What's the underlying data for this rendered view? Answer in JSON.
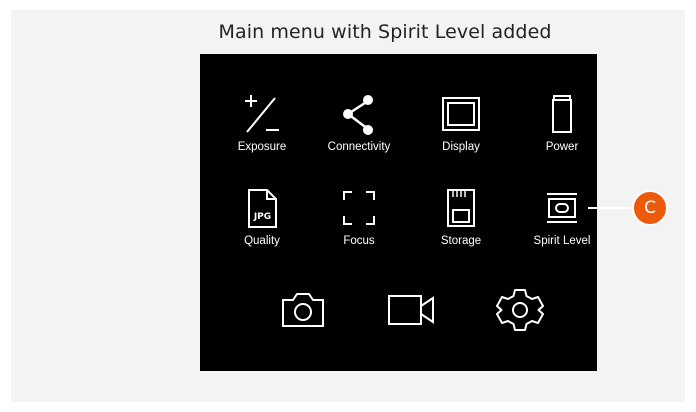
{
  "caption": "Main menu with Spirit Level added",
  "menu": {
    "row1": [
      {
        "label": "Exposure",
        "icon": "exposure-plus-minus-icon"
      },
      {
        "label": "Connectivity",
        "icon": "share-icon"
      },
      {
        "label": "Display",
        "icon": "display-icon"
      },
      {
        "label": "Power",
        "icon": "battery-icon"
      }
    ],
    "row2": [
      {
        "label": "Quality",
        "icon": "jpg-file-icon",
        "badge": "JPG"
      },
      {
        "label": "Focus",
        "icon": "focus-frame-icon"
      },
      {
        "label": "Storage",
        "icon": "sd-card-icon"
      },
      {
        "label": "Spirit Level",
        "icon": "spirit-level-icon"
      }
    ],
    "bottom": [
      {
        "icon": "camera-icon"
      },
      {
        "icon": "video-camera-icon"
      },
      {
        "icon": "settings-gear-icon"
      }
    ]
  },
  "callout": {
    "letter": "C",
    "color": "#ee5a0b"
  }
}
